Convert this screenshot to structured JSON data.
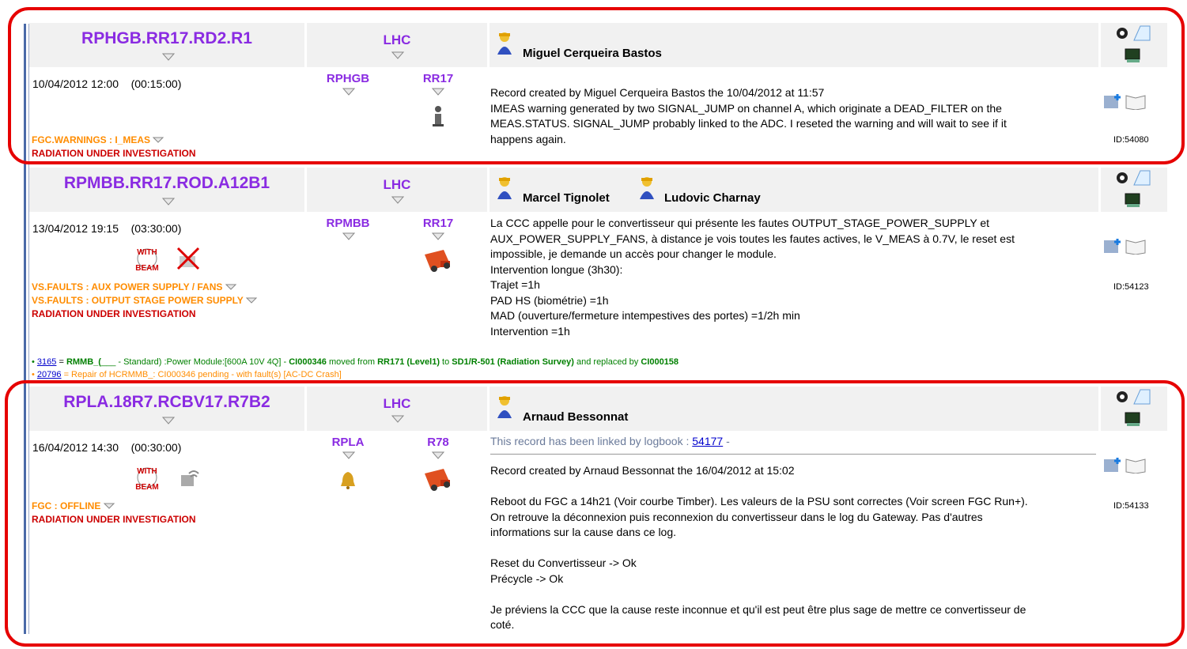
{
  "records": [
    {
      "circuit": "RPHGB.RR17.RD2.R1",
      "machine": "LHC",
      "people": [
        "Miguel Cerqueira Bastos"
      ],
      "datetime": "10/04/2012  12:00",
      "duration": "(00:15:00)",
      "family": "RPHGB",
      "location": "RR17",
      "faults_orange": [
        "FGC.WARNINGS : I_MEAS"
      ],
      "fault_red": "RADIATION UNDER INVESTIGATION",
      "text_lines": [
        "Record created by Miguel Cerqueira Bastos the 10/04/2012 at 11:57",
        "IMEAS warning generated by two SIGNAL_JUMP on channel A, which originate a DEAD_FILTER on the",
        "MEAS.STATUS. SIGNAL_JUMP probably linked to the ADC. I reseted the warning and will wait to see if it",
        "happens again."
      ],
      "id": "ID:54080"
    },
    {
      "circuit": "RPMBB.RR17.ROD.A12B1",
      "machine": "LHC",
      "people": [
        "Marcel Tignolet",
        "Ludovic Charnay"
      ],
      "datetime": "13/04/2012  19:15",
      "duration": "(03:30:00)",
      "family": "RPMBB",
      "location": "RR17",
      "faults_orange": [
        "VS.FAULTS : AUX POWER SUPPLY / FANS",
        "VS.FAULTS : OUTPUT STAGE POWER SUPPLY"
      ],
      "fault_red": "RADIATION UNDER INVESTIGATION",
      "text_lines": [
        "La CCC appelle pour le convertisseur qui présente les fautes OUTPUT_STAGE_POWER_SUPPLY et",
        "AUX_POWER_SUPPLY_FANS, à distance je vois toutes les fautes actives, le V_MEAS à 0.7V, le reset est",
        "impossible, je demande un accès pour changer le module.",
        "",
        "Intervention longue (3h30):",
        "Trajet =1h",
        "PAD HS (biométrie) =1h",
        "MAD (ouverture/fermeture intempestives des portes) =1/2h min",
        "Intervention =1h"
      ],
      "id": "ID:54123",
      "ci1": {
        "link": "3165",
        "eq": " = ",
        "name": "RMMB_(",
        "rest": "___ - Standard) :Power Module:[600A 10V 4Q] - ",
        "ci": "CI000346",
        "moved": " moved from ",
        "from": "RR171 (Level1)",
        "to_word": " to ",
        "to": "SD1/R-501 (Radiation Survey)",
        "repl": " and replaced by ",
        "ci2": "CI000158"
      },
      "ci2": {
        "link": "20796",
        "text": " = Repair of HCRMMB_: CI000346 pending - with fault(s) [AC-DC Crash]"
      }
    },
    {
      "circuit": "RPLA.18R7.RCBV17.R7B2",
      "machine": "LHC",
      "people": [
        "Arnaud Bessonnat"
      ],
      "datetime": "16/04/2012  14:30",
      "duration": "(00:30:00)",
      "family": "RPLA",
      "location": "R78",
      "faults_orange": [
        "FGC : OFFLINE"
      ],
      "fault_red": "RADIATION UNDER INVESTIGATION",
      "linked_prefix": "This record has been linked by logbook : ",
      "linked_id": "54177",
      "linked_suffix": " -",
      "text_lines": [
        "Record created by Arnaud Bessonnat the 16/04/2012 at 15:02",
        "",
        "Reboot du FGC a 14h21 (Voir courbe Timber). Les valeurs de la PSU sont correctes (Voir screen FGC Run+).",
        "On retrouve la déconnexion puis reconnexion du convertisseur dans le log du Gateway. Pas d'autres",
        "informations sur la cause dans ce log.",
        "",
        "Reset du Convertisseur -> Ok",
        "Précycle -> Ok",
        "",
        "Je préviens la CCC que la cause reste inconnue et qu'il est peut être plus sage de mettre ce convertisseur de",
        "coté."
      ],
      "id": "ID:54133"
    }
  ],
  "beam_label": [
    "WITH",
    "BEAM"
  ],
  "colors": {
    "accent": "#8a2be2",
    "orange": "#ff8c00",
    "red": "#cc0000",
    "highlight": "#e60000",
    "green": "#008000"
  },
  "icons": [
    "person-icon",
    "gear-icon",
    "bookmark-icon",
    "monitor-icon",
    "add-record-icon",
    "book-icon",
    "info-icon",
    "truck-icon",
    "bell-icon",
    "with-beam-icon",
    "no-network-icon",
    "signal-icon",
    "filter-gem-icon"
  ]
}
